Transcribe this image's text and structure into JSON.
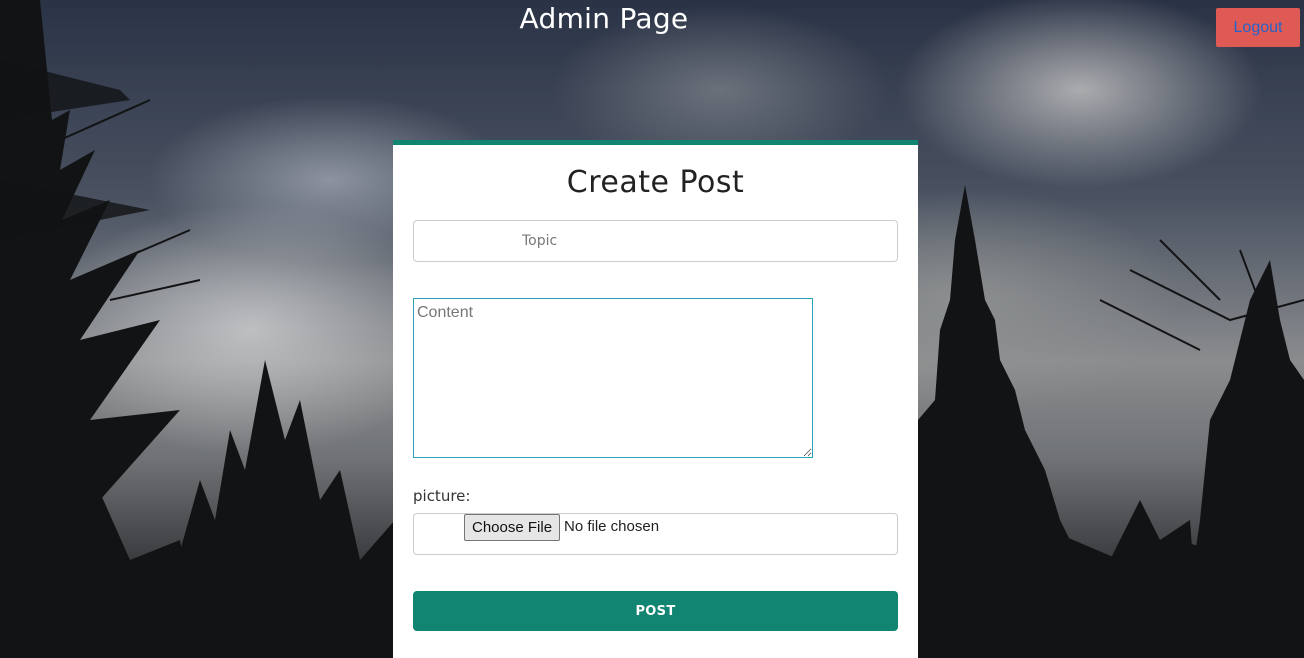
{
  "header": {
    "title": "Admin Page",
    "logout_label": "Logout"
  },
  "form": {
    "title": "Create Post",
    "topic_placeholder": "Topic",
    "topic_value": "",
    "content_placeholder": "Content",
    "content_value": "",
    "picture_label": "picture:",
    "choose_file_label": "Choose File",
    "file_status": "No file chosen",
    "post_label": "POST"
  },
  "colors": {
    "accent": "#128472",
    "logout_bg": "#e05a55",
    "logout_text": "#2563c9",
    "textarea_border": "#2aa3b7"
  }
}
